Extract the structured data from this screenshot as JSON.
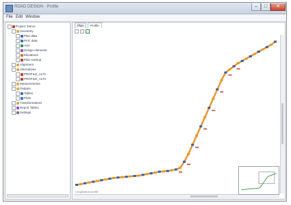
{
  "window": {
    "title": "ROAD DESIGN - Profile",
    "controls": {
      "minimize": "–",
      "maximize": "□",
      "close": "✕"
    }
  },
  "menu": [
    "File",
    "Edit",
    "Window"
  ],
  "sidebar": {
    "items": [
      {
        "label": "Project: Demo",
        "level": 0,
        "icon": "project-icon",
        "color": "#c0392b"
      },
      {
        "label": "Geometry",
        "level": 1,
        "icon": "folder-icon",
        "color": "#d8a64a"
      },
      {
        "label": "Plan data",
        "level": 2,
        "icon": "pencil-icon",
        "color": "#3b6fb6"
      },
      {
        "label": "Prof. data",
        "level": 2,
        "icon": "pencil-icon",
        "color": "#3b6fb6"
      },
      {
        "label": "Axis",
        "level": 2,
        "icon": "axis-icon",
        "color": "#2d8a4e"
      },
      {
        "label": "Design elements",
        "level": 2,
        "icon": "element-icon",
        "color": "#8a5bb0"
      },
      {
        "label": "Elevations",
        "level": 2,
        "icon": "element-icon",
        "color": "#d37a2a"
      },
      {
        "label": "Plan markup",
        "level": 2,
        "icon": "element-icon",
        "color": "#c0392b"
      },
      {
        "label": "Alignment",
        "level": 1,
        "icon": "folder-icon",
        "color": "#d8a64a"
      },
      {
        "label": "Alternatives",
        "level": 1,
        "icon": "folder-icon",
        "color": "#d8a64a"
      },
      {
        "label": "PROFILE_ALT1",
        "level": 2,
        "icon": "profile-icon",
        "color": "#c0392b"
      },
      {
        "label": "PROFILE_ALT2",
        "level": 2,
        "icon": "profile-icon",
        "color": "#c0392b"
      },
      {
        "label": "Measurements",
        "level": 1,
        "icon": "folder-icon",
        "color": "#d8a64a"
      },
      {
        "label": "Outputs",
        "level": 1,
        "icon": "folder-icon",
        "color": "#d8a64a"
      },
      {
        "label": "Tables",
        "level": 2,
        "icon": "table-icon",
        "color": "#3b6fb6"
      },
      {
        "label": "Plots",
        "level": 2,
        "icon": "plot-icon",
        "color": "#3b6fb6"
      },
      {
        "label": "Transformations",
        "level": 1,
        "icon": "folder-icon",
        "color": "#d8a64a"
      },
      {
        "label": "Report Tables",
        "level": 1,
        "icon": "report-icon",
        "color": "#8a5bb0"
      },
      {
        "label": "Settings",
        "level": 1,
        "icon": "gear-icon",
        "color": "#6b7280"
      }
    ]
  },
  "tabs": [
    {
      "label": "Plan",
      "active": false
    },
    {
      "label": "Profile",
      "active": true
    }
  ],
  "toolbar": {
    "icons": [
      "select-icon",
      "zoom-icon",
      "pan-icon"
    ]
  },
  "status": {
    "text": "Longitudinal profile"
  },
  "chart_data": {
    "type": "line",
    "series": [
      {
        "color": "#e8962e",
        "points": [
          [
            0,
            4
          ],
          [
            6,
            5
          ],
          [
            12,
            6
          ],
          [
            18,
            7
          ],
          [
            24,
            8
          ],
          [
            30,
            9
          ],
          [
            36,
            10
          ],
          [
            42,
            11
          ],
          [
            48,
            12
          ],
          [
            54,
            13
          ],
          [
            60,
            13.5
          ],
          [
            66,
            14
          ],
          [
            72,
            14.5
          ],
          [
            78,
            15
          ],
          [
            84,
            15.5
          ],
          [
            90,
            16
          ],
          [
            96,
            17
          ],
          [
            102,
            18
          ],
          [
            108,
            19
          ],
          [
            114,
            20
          ],
          [
            120,
            21
          ],
          [
            126,
            21.5
          ],
          [
            132,
            22
          ],
          [
            138,
            23
          ],
          [
            144,
            24
          ],
          [
            150,
            26
          ],
          [
            156,
            34
          ],
          [
            162,
            44
          ],
          [
            168,
            56
          ],
          [
            174,
            68
          ],
          [
            180,
            80
          ],
          [
            186,
            92
          ],
          [
            192,
            104
          ],
          [
            198,
            116
          ],
          [
            204,
            128
          ],
          [
            210,
            140
          ],
          [
            216,
            150
          ],
          [
            222,
            154
          ],
          [
            228,
            158
          ],
          [
            234,
            162
          ],
          [
            240,
            165
          ],
          [
            246,
            168
          ],
          [
            252,
            171
          ],
          [
            258,
            174
          ],
          [
            264,
            177
          ],
          [
            270,
            180
          ],
          [
            276,
            183
          ],
          [
            282,
            186
          ],
          [
            288,
            190
          ]
        ]
      }
    ],
    "markers": {
      "blue": "#2f5fa8",
      "orange": "#e8962e",
      "label_red": "#c0392b"
    },
    "minimap_line_color": "#3a9a3a"
  }
}
